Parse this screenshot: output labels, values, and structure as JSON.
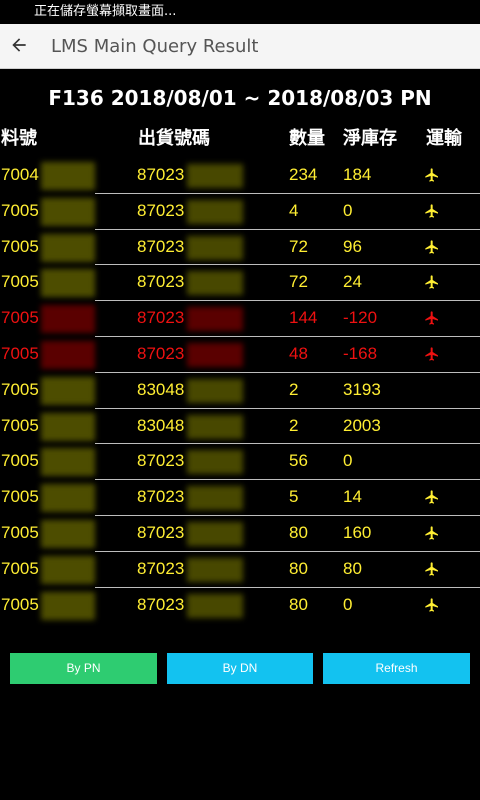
{
  "status_bar": {
    "text": "正在儲存螢幕擷取畫面..."
  },
  "app_bar": {
    "title": "LMS Main Query Result"
  },
  "query_title": "F136 2018/08/01 ~ 2018/08/03 PN",
  "columns": {
    "part_no": "料號",
    "dn": "出貨號碼",
    "qty": "數量",
    "net_stock": "淨庫存",
    "transport": "運輸"
  },
  "colors": {
    "normal": "#ffee33",
    "alert": "#ee1111",
    "green_btn": "#2ecc71",
    "blue_btn": "#13c2f0"
  },
  "rows": [
    {
      "part": "7004",
      "dn": "87023",
      "qty": "234",
      "net": "184",
      "air": true,
      "alert": false
    },
    {
      "part": "7005",
      "dn": "87023",
      "qty": "4",
      "net": "0",
      "air": true,
      "alert": false
    },
    {
      "part": "7005",
      "dn": "87023",
      "qty": "72",
      "net": "96",
      "air": true,
      "alert": false
    },
    {
      "part": "7005",
      "dn": "87023",
      "qty": "72",
      "net": "24",
      "air": true,
      "alert": false
    },
    {
      "part": "7005",
      "dn": "87023",
      "qty": "144",
      "net": "-120",
      "air": true,
      "alert": true
    },
    {
      "part": "7005",
      "dn": "87023",
      "qty": "48",
      "net": "-168",
      "air": true,
      "alert": true
    },
    {
      "part": "7005",
      "dn": "83048",
      "qty": "2",
      "net": "3193",
      "air": false,
      "alert": false
    },
    {
      "part": "7005",
      "dn": "83048",
      "qty": "2",
      "net": "2003",
      "air": false,
      "alert": false
    },
    {
      "part": "7005",
      "dn": "87023",
      "qty": "56",
      "net": "0",
      "air": false,
      "alert": false
    },
    {
      "part": "7005",
      "dn": "87023",
      "qty": "5",
      "net": "14",
      "air": true,
      "alert": false
    },
    {
      "part": "7005",
      "dn": "87023",
      "qty": "80",
      "net": "160",
      "air": true,
      "alert": false
    },
    {
      "part": "7005",
      "dn": "87023",
      "qty": "80",
      "net": "80",
      "air": true,
      "alert": false
    },
    {
      "part": "7005",
      "dn": "87023",
      "qty": "80",
      "net": "0",
      "air": true,
      "alert": false
    }
  ],
  "buttons": {
    "by_pn": "By PN",
    "by_dn": "By DN",
    "refresh": "Refresh"
  },
  "icons": {
    "back": "arrow-left-icon",
    "transport": "airplane-icon"
  }
}
